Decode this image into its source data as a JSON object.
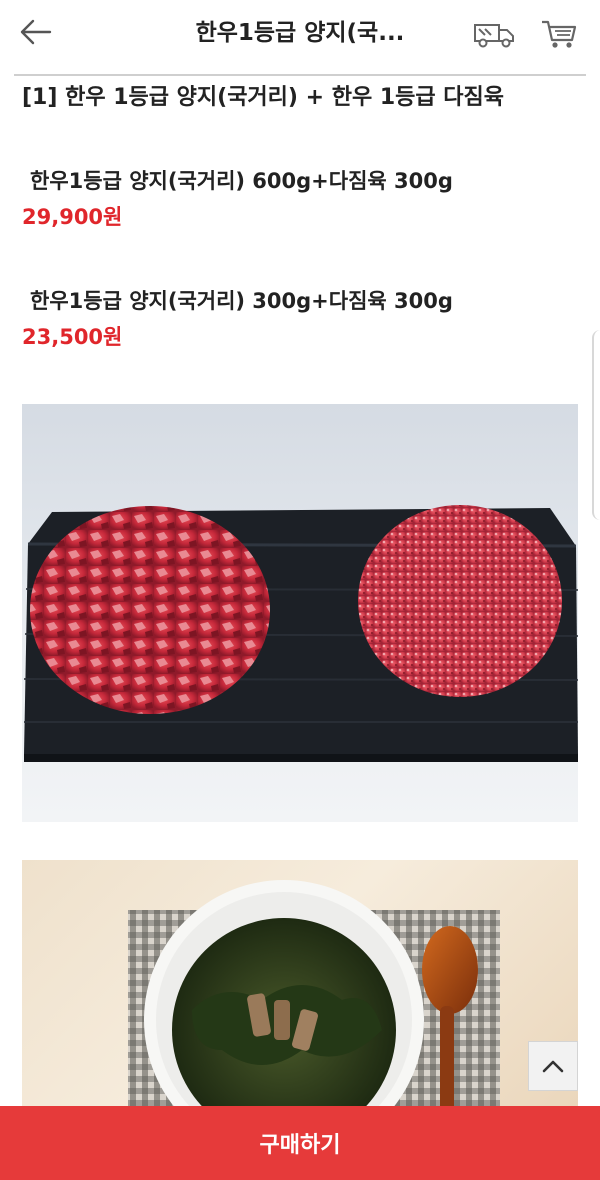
{
  "header": {
    "title": "한우1등급 양지(국...",
    "icons": {
      "back": "back-arrow-icon",
      "delivery": "delivery-truck-icon",
      "cart": "shopping-cart-icon"
    }
  },
  "product": {
    "title": "[1] 한우 1등급 양지(국거리) + 한우 1등급 다짐육"
  },
  "options": [
    {
      "name": "한우1등급 양지(국거리) 600g+다짐육 300g",
      "price": "29,900원"
    },
    {
      "name": "한우1등급 양지(국거리) 300g+다짐육 300g",
      "price": "23,500원"
    }
  ],
  "images": [
    {
      "name": "brisket-and-ground-beef-on-black-tray"
    },
    {
      "name": "seaweed-soup-with-wooden-spoon"
    }
  ],
  "buy_button": {
    "label": "구매하기"
  },
  "colors": {
    "price": "#e0262b",
    "buy_bar": "#e63a3a"
  }
}
